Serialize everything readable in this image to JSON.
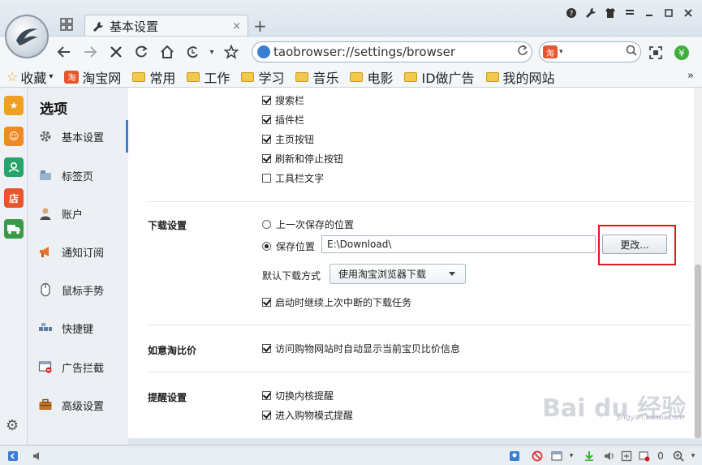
{
  "tab": {
    "title": "基本设置",
    "close": "×",
    "new_tab": "+"
  },
  "address": {
    "url": "taobrowser://settings/browser"
  },
  "search": {
    "engine_logo": "淘",
    "caret": "▾",
    "placeholder": ""
  },
  "bookmarks": {
    "favorites_label": "收藏",
    "items": [
      {
        "label": "淘宝网",
        "icon": "taobao-icon"
      },
      {
        "label": "常用",
        "icon": "folder-icon"
      },
      {
        "label": "工作",
        "icon": "folder-icon"
      },
      {
        "label": "学习",
        "icon": "folder-icon"
      },
      {
        "label": "音乐",
        "icon": "folder-icon"
      },
      {
        "label": "电影",
        "icon": "folder-icon"
      },
      {
        "label": "ID做广告",
        "icon": "folder-icon"
      },
      {
        "label": "我的网站",
        "icon": "folder-icon"
      }
    ],
    "more": "»"
  },
  "side_strip": {
    "shop_label": "店",
    "colors": [
      "#f0a020",
      "#f08a24",
      "#27a36b",
      "#e8542b",
      "#3a9a4a"
    ]
  },
  "nav": {
    "title": "选项",
    "items": [
      {
        "label": "基本设置",
        "icon": "gear-icon",
        "active": true
      },
      {
        "label": "标签页",
        "icon": "tab-icon"
      },
      {
        "label": "账户",
        "icon": "user-icon"
      },
      {
        "label": "通知订阅",
        "icon": "megaphone-icon"
      },
      {
        "label": "鼠标手势",
        "icon": "mouse-icon"
      },
      {
        "label": "快捷键",
        "icon": "keyboard-icon"
      },
      {
        "label": "广告拦截",
        "icon": "ad-block-icon"
      },
      {
        "label": "高级设置",
        "icon": "briefcase-icon"
      }
    ]
  },
  "toolbar_options": [
    {
      "label": "搜索栏",
      "checked": true
    },
    {
      "label": "插件栏",
      "checked": true
    },
    {
      "label": "主页按钮",
      "checked": true
    },
    {
      "label": "刷新和停止按钮",
      "checked": true
    },
    {
      "label": "工具栏文字",
      "checked": false
    }
  ],
  "download": {
    "section_label": "下载设置",
    "last_location_label": "上一次保存的位置",
    "save_location_label": "保存位置",
    "path": "E:\\Download\\",
    "change_button": "更改...",
    "default_method_label": "默认下载方式",
    "default_method_value": "使用淘宝浏览器下载",
    "resume_label": "启动时继续上次中断的下载任务",
    "resume_checked": true,
    "selected": "save_location"
  },
  "price_compare": {
    "section_label": "如意淘比价",
    "option_label": "访问购物网站时自动显示当前宝贝比价信息",
    "checked": true
  },
  "reminders": {
    "section_label": "提醒设置",
    "items": [
      {
        "label": "切换内核提醒",
        "checked": true
      },
      {
        "label": "进入购物模式提醒",
        "checked": true
      }
    ]
  },
  "watermark": {
    "text": "Bai du 经验",
    "sub": "jingyan.baidu.com"
  },
  "accent_color": "#3b7fd0",
  "highlight_color": "#e0191e"
}
